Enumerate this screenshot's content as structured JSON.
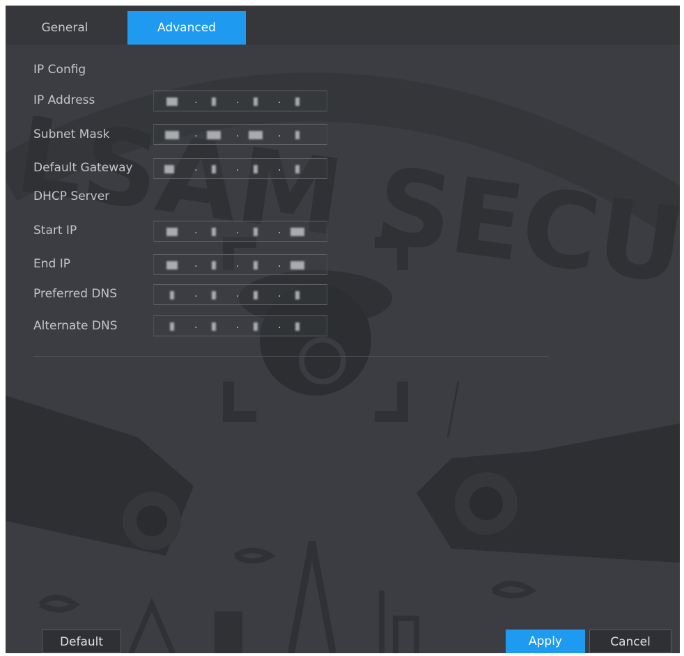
{
  "tabs": [
    {
      "label": "General",
      "active": false
    },
    {
      "label": "Advanced",
      "active": true
    }
  ],
  "section_ip_config": "IP Config",
  "fields": {
    "ip_address": {
      "label": "IP Address",
      "octets": [
        "17",
        "1",
        "1",
        "1"
      ]
    },
    "subnet_mask": {
      "label": "Subnet Mask",
      "octets": [
        "255",
        "255",
        "255",
        "0"
      ]
    },
    "default_gateway": {
      "label": "Default Gateway",
      "octets": [
        "11",
        "1",
        "1",
        "1"
      ]
    },
    "start_ip": {
      "label": "Start IP",
      "octets": [
        "17",
        "1",
        "1",
        "100"
      ]
    },
    "end_ip": {
      "label": "End IP",
      "octets": [
        "22",
        "1",
        "1",
        "200"
      ]
    },
    "preferred_dns": {
      "label": "Preferred DNS",
      "octets": [
        "8",
        "8",
        "8",
        "8"
      ]
    },
    "alternate_dns": {
      "label": "Alternate DNS",
      "octets": [
        "4",
        "4",
        "4",
        "4"
      ]
    }
  },
  "section_dhcp_server": "DHCP Server",
  "watermark_text": "LSAM SECURITY",
  "buttons": {
    "default": "Default",
    "apply": "Apply",
    "cancel": "Cancel"
  },
  "colors": {
    "accent": "#1e9bf0",
    "panel_bg": "#3b3d42",
    "text": "#c3c5c8"
  }
}
